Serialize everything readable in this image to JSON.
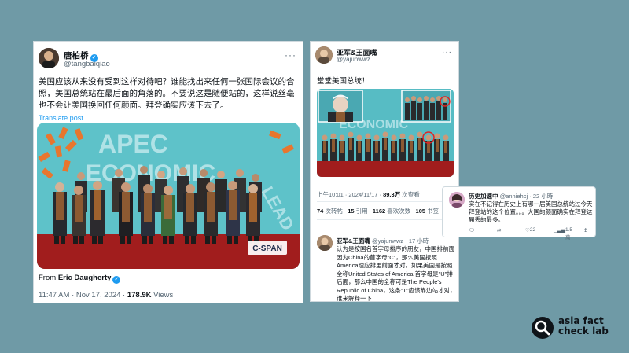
{
  "tweet1": {
    "name": "唐柏桥",
    "handle": "@tangbaiqiao",
    "more": "···",
    "text": "美国应该从来没有受到这样对待吧？谁能找出来任何一张国际会议的合照，美国总统站在最后面的角落的。不要说这是随便站的，这样说丝毫也不会让美国换回任何颜面。拜登确实应该下去了。",
    "translate_label": "Translate post",
    "image": {
      "banner_line1": "APEC",
      "banner_line2": "ECONOMIC",
      "banner_side": "LEAD",
      "watermark": "C-SPAN"
    },
    "from_prefix": "From",
    "from_name": "Eric Daugherty",
    "time": "11:47 AM · Nov 17, 2024 · ",
    "views_count": "178.9K",
    "views_label": " Views"
  },
  "tweet2": {
    "name": "亚军&王面嘴",
    "handle": "@yajunwwz",
    "more": "···",
    "text": "堂堂美国总统！",
    "image": {
      "banner": "ECONOMIC"
    },
    "time": "上午10:01 · 2024/11/17 · ",
    "views_count": "89.3万",
    "views_label": "次查看",
    "reposts_count": "74",
    "reposts_label": "次转帖",
    "quotes_count": "15",
    "quotes_label": "引用",
    "likes_count": "1162",
    "likes_label": "喜欢次数",
    "bookmarks_count": "105",
    "bookmarks_label": "书签"
  },
  "reply": {
    "name": "亚军&王面嘴",
    "handle": "@yajunwwz",
    "time": "· 17 小時",
    "text": "认为是按国名首字母排序的朋友，中国排前面因为China的首字母\"C\"，那么美国按照America理应排更前面才对，如果美国是按照全称United States of America 首字母是\"U\"排后面，那么中国的全称可是The People's Republic of China，这条\"T\"应该靠边站才对，谁来解释一下"
  },
  "tweet3": {
    "name": "历史加速中",
    "handle": "@anniehcj",
    "time": "· 22 小時",
    "text": "实在不记得在历史上有哪一届美国总统站过今天拜登站的这个位置。。。大国的颜面确实在拜登这届丢的最多。",
    "replies": "",
    "reposts": "",
    "likes": "22",
    "views": "1.5萬"
  },
  "logo": {
    "line1": "asia fact",
    "line2": "check lab"
  },
  "colors": {
    "background": "#6f9aa6",
    "link": "#1d9bf0",
    "apec_teal": "#5ec2c9",
    "carpet_red": "#a11d1d"
  }
}
